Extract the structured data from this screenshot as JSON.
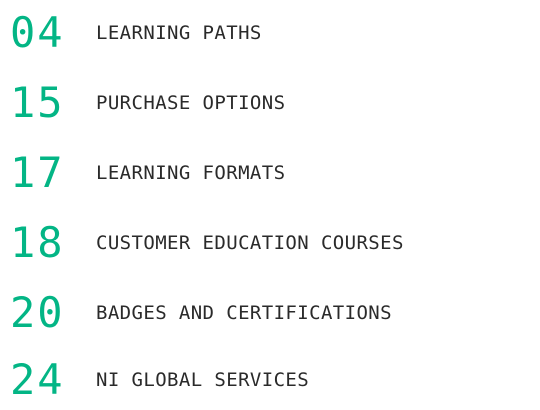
{
  "toc": {
    "items": [
      {
        "page": "04",
        "title": "LEARNING PATHS"
      },
      {
        "page": "15",
        "title": "PURCHASE OPTIONS"
      },
      {
        "page": "17",
        "title": "LEARNING FORMATS"
      },
      {
        "page": "18",
        "title": "CUSTOMER EDUCATION COURSES"
      },
      {
        "page": "20",
        "title": "BADGES AND CERTIFICATIONS"
      },
      {
        "page": "24",
        "title": "NI GLOBAL SERVICES"
      }
    ]
  },
  "colors": {
    "accent": "#03b585",
    "text": "#2a2a2a",
    "background": "#ffffff"
  }
}
